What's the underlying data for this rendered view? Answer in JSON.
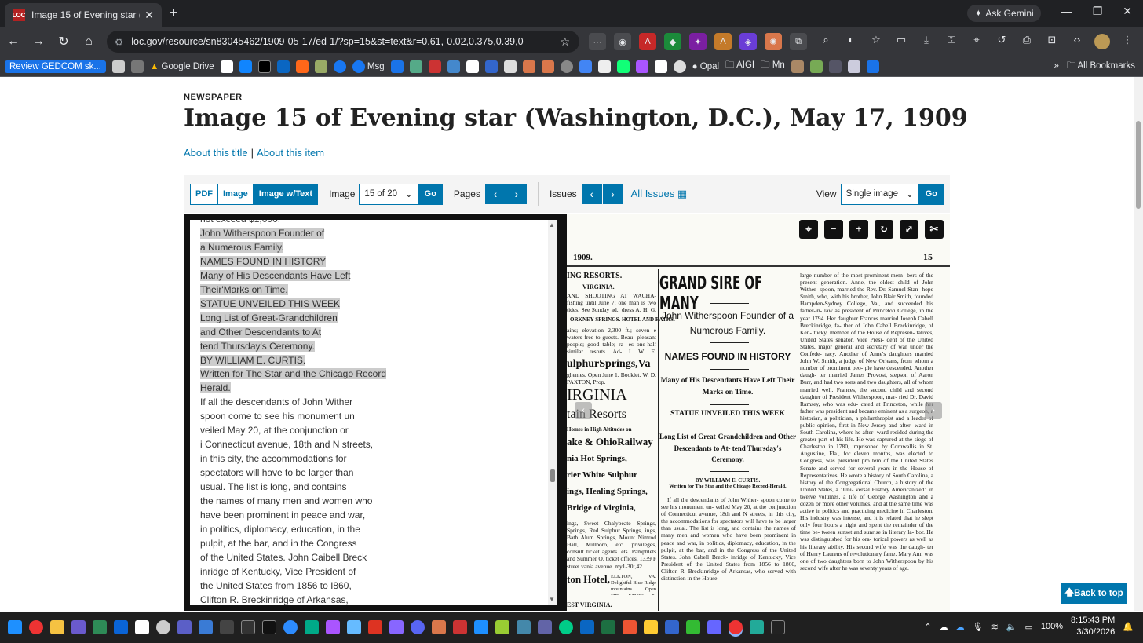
{
  "browser": {
    "tab_title": "Image 15 of Evening star (Wash",
    "favicon_text": "LOC",
    "ask_gemini": "Ask Gemini",
    "url": "loc.gov/resource/sn83045462/1909-05-17/ed-1/?sp=15&st=text&r=0.61,-0.02,0.375,0.39,0",
    "bookmarks": [
      "Review GEDCOM sk...",
      "Google Drive",
      "Msg",
      "Opal",
      "AIGI",
      "Mn"
    ],
    "all_bookmarks": "All Bookmarks"
  },
  "page": {
    "kicker": "NEWSPAPER",
    "title": "Image 15 of Evening star (Washington, D.C.), May 17, 1909",
    "link_about_title": "About this title",
    "link_separator": "|",
    "link_about_item": "About this item"
  },
  "controls": {
    "fmt_pdf": "PDF",
    "fmt_image": "Image",
    "fmt_image_text": "Image w/Text",
    "image_label": "Image",
    "image_select": "15 of 20",
    "go": "Go",
    "pages_label": "Pages",
    "issues_label": "Issues",
    "all_issues": "All Issues",
    "view_label": "View",
    "view_select": "Single image",
    "view_go": "Go"
  },
  "ocr_text": [
    {
      "t": "not exceed $1,000.",
      "hl": false
    },
    {
      "t": "John Witherspoon Founder of",
      "hl": true
    },
    {
      "t": "a Numerous Family.",
      "hl": true
    },
    {
      "t": "NAMES FOUND IN HISTORY",
      "hl": true
    },
    {
      "t": "Many of His Descendants Have Left",
      "hl": true
    },
    {
      "t": "Their'Marks on Time.",
      "hl": true
    },
    {
      "t": "STATUE UNVEILED THIS WEEK",
      "hl": true
    },
    {
      "t": "Long List of Great-Grandchildren",
      "hl": true
    },
    {
      "t": "and Other Descendants to At",
      "hl": true
    },
    {
      "t": "tend Thursday's Ceremony.",
      "hl": true
    },
    {
      "t": "BY WILLIAM E. CURTIS.",
      "hl": true
    },
    {
      "t": "Written for The Star and the Chicago Record",
      "hl": true
    },
    {
      "t": "Herald.",
      "hl": true
    },
    {
      "t": "If all the descendants of John Wither",
      "hl": false
    },
    {
      "t": "spoon come to see his monument un",
      "hl": false
    },
    {
      "t": "veiled May 20, at the conjunction or",
      "hl": false
    },
    {
      "t": "i Connecticut avenue, 18th and N streets,",
      "hl": false
    },
    {
      "t": "in this city, the accommodations for",
      "hl": false
    },
    {
      "t": "spectators will have to be larger than",
      "hl": false
    },
    {
      "t": "usual. The list is long, and contains",
      "hl": false
    },
    {
      "t": "the names of many men and women who",
      "hl": false
    },
    {
      "t": "have been prominent in peace and war,",
      "hl": false
    },
    {
      "t": "in politics, diplomacy, education, in the",
      "hl": false
    },
    {
      "t": "pulpit, at the bar, and in the Congress",
      "hl": false
    },
    {
      "t": "of the United States. John Caibell Breck",
      "hl": false
    },
    {
      "t": "inridge of Kentucky, Vice President of",
      "hl": false
    },
    {
      "t": "the United States from 1856 to I860,",
      "hl": false
    },
    {
      "t": "Clifton R. Breckinridge of Arkansas,",
      "hl": false
    }
  ],
  "newspaper": {
    "year": "1909.",
    "page_no": "15",
    "left_head1": "ING RESORTS.",
    "left_head2": "VIRGINIA.",
    "left_text1": "AND SHOOTING AT WACHA- fishing until June 7; one man is two tides. See Sunday ad., dress A. H. G. MEARS, Wacha-",
    "left_head3": "ORKNEY SPRINGS. HOTEL AND BATHS.",
    "left_text2": "ains; elevation 2,300 ft.; seven e waters free to guests. Beau- pleasant people; good table; ra- es one-half similar resorts. Ad- J. W. E. FAIRFIELD, care",
    "left_sulphur": "ulphurSprings,Va",
    "left_text3": "ghenies. Open June 1. Booklet. W. D. PAXTON, Prop.",
    "left_virginia": "IRGINIA",
    "left_resorts": "tain Resorts",
    "left_text4": "Homes in High Altitudes on",
    "left_railway": "ake & OhioRailway",
    "left_hot": "nia Hot Springs,",
    "left_white": "rier White Sulphur",
    "left_healing": "ings, Healing Springs,",
    "left_bridge": "Bridge of Virginia,",
    "left_text5": "ings, Sweet Chalybeate Springs, Springs, Red Sulphur Springs, ings, Bath Alum Springs, Mount Nimrod Hall, Millboro, etc. privileges, consult ticket agents. ets. Pamphlets and Summer O. ticket offices, 1339 F street vania avenue. my1-30t,42",
    "left_hotel": "ton Hotel,",
    "left_text6": "ELKTON, VA. Delightful Blue Ridge mountains. Open Mrs. EMMA S. DRAWBAUGH.",
    "left_bottom": "EST VIRGINIA.",
    "mid_head1": "GRAND SIRE OF MANY",
    "mid_head2": "John Witherspoon Founder of a Numerous Family.",
    "mid_head3": "NAMES FOUND IN HISTORY",
    "mid_head4": "Many of His Descendants Have Left Their Marks on Time.",
    "mid_head5": "STATUE UNVEILED THIS WEEK",
    "mid_head6": "Long List of Great-Grandchildren and Other Descendants to At- tend Thursday's Ceremony.",
    "mid_byline": "BY WILLIAM E. CURTIS.",
    "mid_written": "Written for The Star and the Chicago Record-Herald.",
    "mid_body": "If all the descendants of John Wither- spoon come to see his monument un- veiled May 20, at the conjunction of Connecticut avenue, 18th and N streets, in this city, the accommodations for spectators will have to be larger than usual. The list is long, and contains the names of many men and women who have been prominent in peace and war, in politics, diplomacy, education, in the pulpit, at the bar, and in the Congress of the United States. John Cabell Breck- inridge of Kentucky, Vice President of the United States from 1856 to 1860, Clifton R. Breckinridge of Arkansas, who served with distinction in the House",
    "right_body": "large number of the most prominent mem- bers of the present generation. Anne, the oldest child of John Wither- spoon, married the Rev. Dr. Samuel Stan- hope Smith, who, with his brother, John Blair Smith, founded Hampden-Sydney College, Va., and succeeded his father-in- law as president of Princeton College, in the year 1794. Her daughter Frances married Joseph Cabell Breckinridge, fa- ther of John Cabell Breckinridge, of Ken- tucky, member of the House of Represen- tatives, United States senator, Vice Presi- dent of the United States, major general and secretary of war under the Confede- racy. Another of Anne's daughters married John W. Smith, a judge of New Orleans, from whom a number of prominent peo- ple have descended. Another daugh- ter married James Provost, stepson of Aaron Burr, and had two sons and two daughters, all of whom married well. Frances, the second child and second daughter of President Witherspoon, mar- ried Dr. David Ramsey, who was edu- cated at Princeton, while her father was president and became eminent as a surgeon, a historian, a politician, a philanthropist and a leader of public opinion, first in New Jersey and after- ward in South Carolina, where he after- ward resided during the greater part of his life. He was captured at the siege of Charleston in 1780, imprisoned by Cornwallis in St. Augustine, Fla., for eleven months, was elected to Congress, was president pro tem of the United States Senate and served for several years in the House of Representatives. He wrote a history of South Carolina, a history of the Congregational Church, a history of the United States, a \"Uni- versal History Americanized\" in twelve volumes, a life of George Washington and a dozen or more other volumes, and at the same time was active in politics and practicing medicine in Charleston. His industry was intense, and it is related that he slept only four hours a night and spent the remainder of the time be- tween sunset and sunrise in literary la- bor. He was distinguished for his ora- torical powers as well as his literary ability. His second wife was the daugh- ter of Henry Laurens of revolutionary fame. Mary Ann was one of two daughters born to John Witherspoon by his second wife after he was seventy years of age."
  },
  "back_to_top": "Back to top",
  "taskbar": {
    "battery": "100%",
    "time": "8:15:43 PM",
    "date": "3/30/2026"
  },
  "colors": {
    "loc_blue": "#0076ad",
    "chrome_dark": "#202124",
    "chrome_toolbar": "#35363a"
  }
}
